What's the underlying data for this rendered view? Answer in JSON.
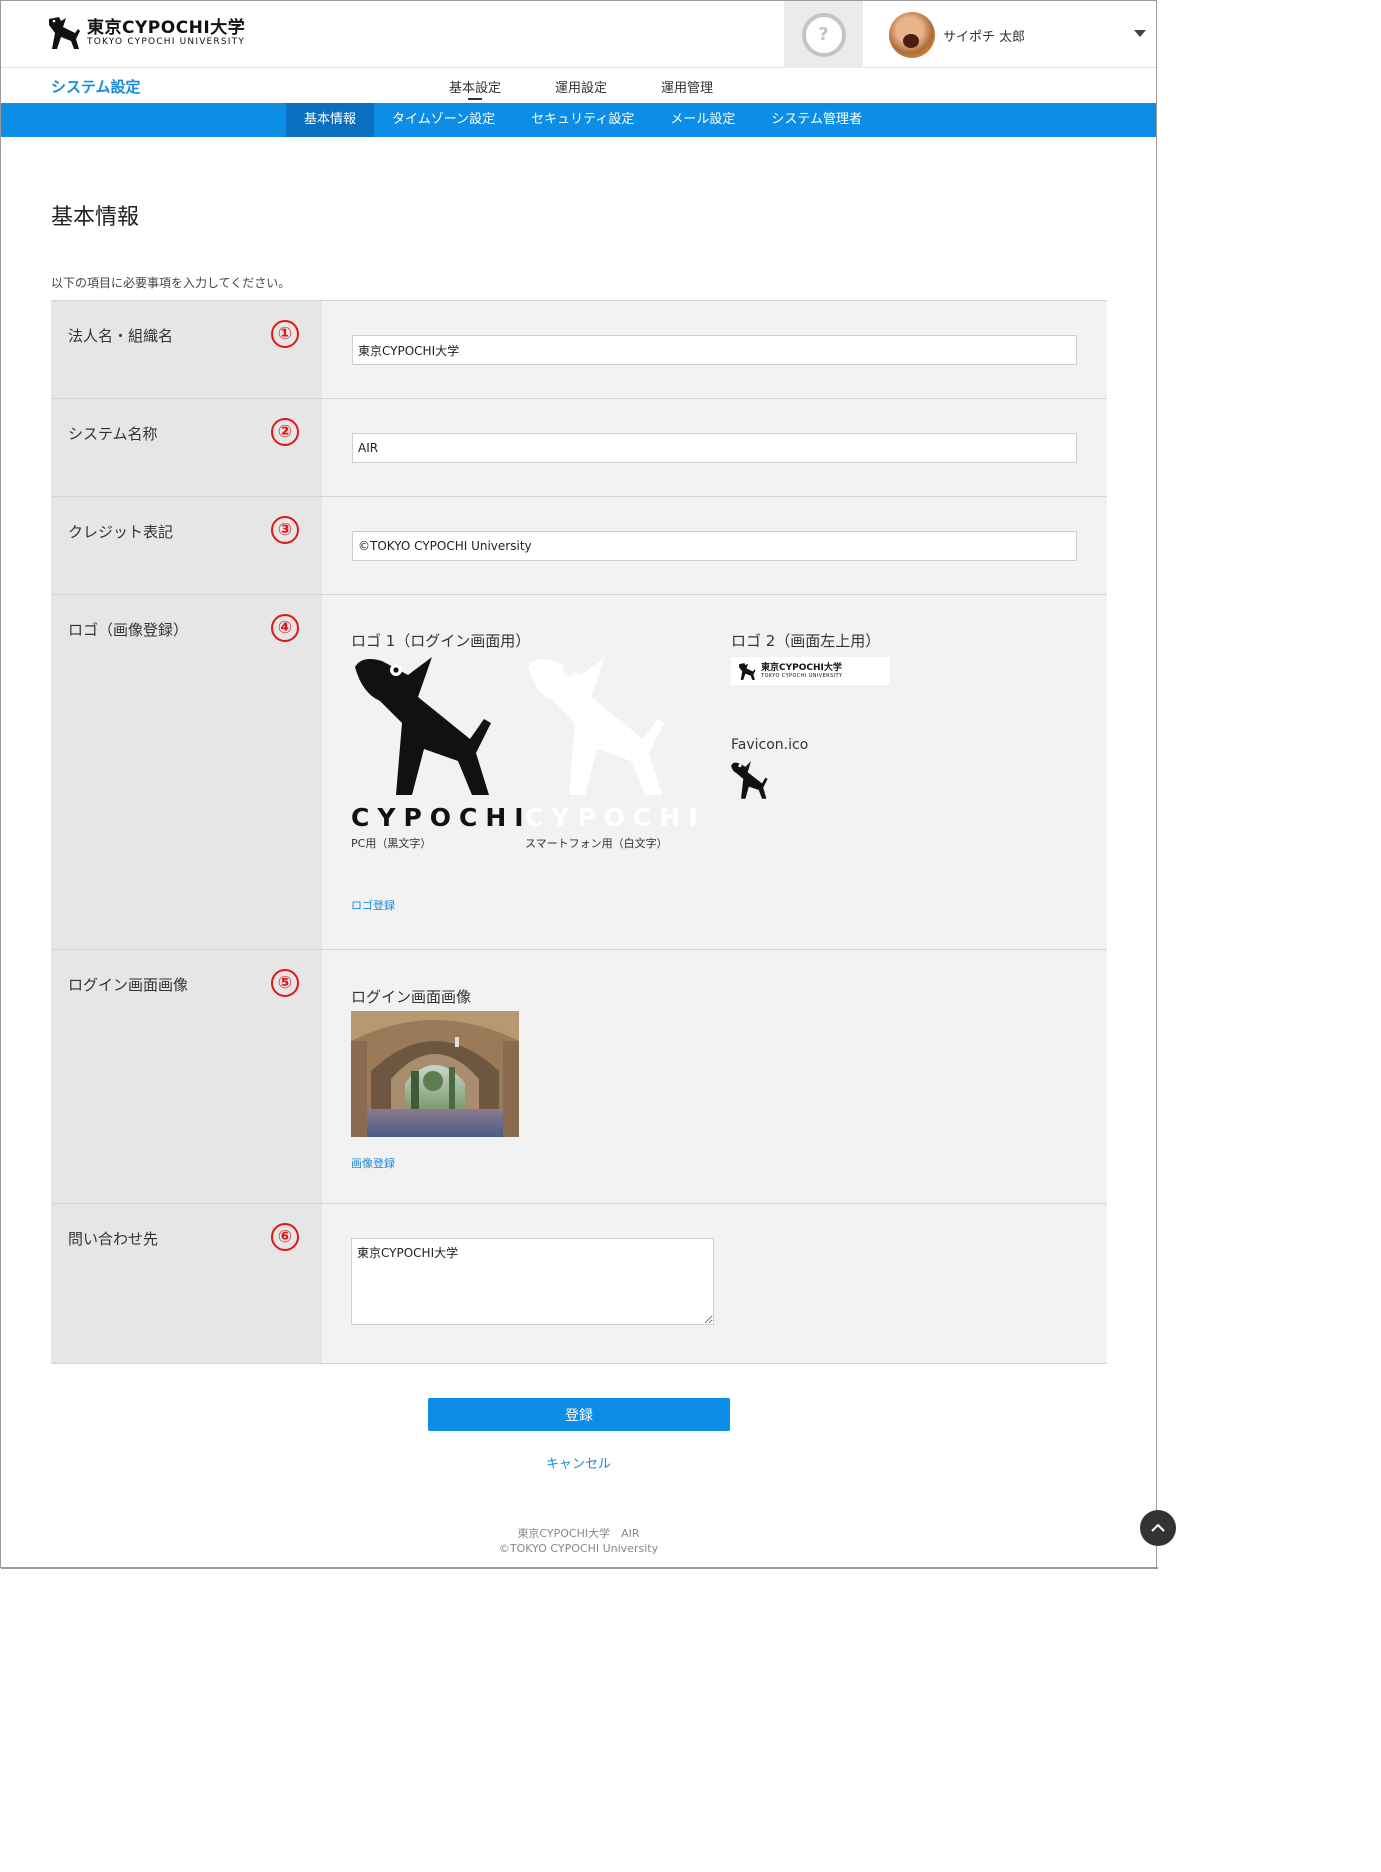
{
  "header": {
    "brand_jp": "東京CYPOCHI大学",
    "brand_en": "TOKYO CYPOCHI UNIVERSITY",
    "help_symbol": "?",
    "user_name": "サイポチ 太郎"
  },
  "subnav": {
    "section_title": "システム設定",
    "tabs": [
      "基本設定",
      "運用設定",
      "運用管理"
    ]
  },
  "bluebar": {
    "tabs": [
      "基本情報",
      "タイムゾーン設定",
      "セキュリティ設定",
      "メール設定",
      "システム管理者"
    ]
  },
  "page": {
    "title": "基本情報",
    "intro": "以下の項目に必要事項を入力してください。"
  },
  "form": {
    "org_name": {
      "label": "法人名・組織名",
      "num": "①",
      "value": "東京CYPOCHI大学"
    },
    "system_name": {
      "label": "システム名称",
      "num": "②",
      "value": "AIR"
    },
    "credit": {
      "label": "クレジット表記",
      "num": "③",
      "value": "©TOKYO CYPOCHI University"
    },
    "logo": {
      "label": "ロゴ（画像登録）",
      "num": "④",
      "logo1_heading": "ロゴ 1（ログイン画面用）",
      "wordmark": "CYPOCHI",
      "pc_caption": "PC用（黒文字）",
      "sp_caption": "スマートフォン用（白文字）",
      "logo2_heading": "ロゴ 2（画面左上用）",
      "logo2_jp": "東京CYPOCHI大学",
      "logo2_en": "TOKYO CYPOCHI UNIVERSITY",
      "favicon_heading": "Favicon.ico",
      "register_link": "ロゴ登録"
    },
    "login_image": {
      "label": "ログイン画面画像",
      "num": "⑤",
      "heading": "ログイン画面画像",
      "register_link": "画像登録"
    },
    "contact": {
      "label": "問い合わせ先",
      "num": "⑥",
      "value": "東京CYPOCHI大学"
    }
  },
  "actions": {
    "submit": "登録",
    "cancel": "キャンセル"
  },
  "footer": {
    "line1": "東京CYPOCHI大学　AIR",
    "line2": "©TOKYO CYPOCHI University"
  },
  "colors": {
    "accent": "#0d8ee6",
    "number_badge": "#e01818"
  }
}
